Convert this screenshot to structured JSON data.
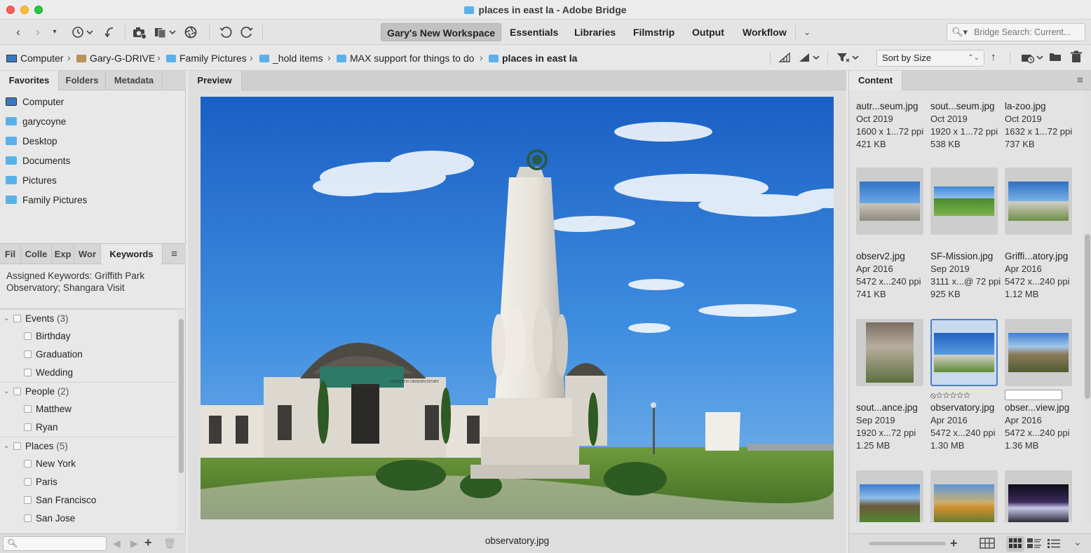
{
  "window": {
    "title": "places in east la - Adobe Bridge"
  },
  "toolbar": {
    "workspaces": [
      "Gary's New Workspace",
      "Essentials",
      "Libraries",
      "Filmstrip",
      "Output",
      "Workflow"
    ],
    "search_placeholder": "Bridge Search: Current..."
  },
  "path": {
    "crumbs": [
      "Computer",
      "Gary-G-DRIVE",
      "Family Pictures",
      "_hold items",
      "MAX support for things to do",
      "places in east la"
    ],
    "sort_label": "Sort by Size"
  },
  "left_panel": {
    "top_tabs": [
      "Favorites",
      "Folders",
      "Metadata"
    ],
    "favorites": [
      "Computer",
      "garycoyne",
      "Desktop",
      "Documents",
      "Pictures",
      "Family Pictures"
    ],
    "bottom_tabs": [
      "Fil",
      "Colle",
      "Exp",
      "Wor",
      "Keywords"
    ],
    "assigned_keywords": "Assigned Keywords: Griffith Park Observatory; Shangara Visit",
    "keywords": [
      {
        "label": "Events",
        "count": "(3)",
        "children": [
          "Birthday",
          "Graduation",
          "Wedding"
        ]
      },
      {
        "label": "People",
        "count": "(2)",
        "children": [
          "Matthew",
          "Ryan"
        ]
      },
      {
        "label": "Places",
        "count": "(5)",
        "children": [
          "New York",
          "Paris",
          "San Francisco",
          "San Jose"
        ]
      }
    ]
  },
  "preview": {
    "tab": "Preview",
    "caption": "observatory.jpg",
    "sign_text": "GRIFFITH OBSERVATORY"
  },
  "content": {
    "tab": "Content",
    "items": [
      {
        "name": "autr...seum.jpg",
        "date": "Oct 2019",
        "dims": "1600 x 1...72 ppi",
        "size": "421 KB"
      },
      {
        "name": "sout...seum.jpg",
        "date": "Oct 2019",
        "dims": "1920 x 1...72 ppi",
        "size": "538 KB"
      },
      {
        "name": "la-zoo.jpg",
        "date": "Oct 2019",
        "dims": "1632 x 1...72 ppi",
        "size": "737 KB"
      },
      {
        "name": "observ2.jpg",
        "date": "Apr 2016",
        "dims": "5472 x...240 ppi",
        "size": "741 KB"
      },
      {
        "name": "SF-Mission.jpg",
        "date": "Sep 2019",
        "dims": "3111 x...@ 72 ppi",
        "size": "925 KB"
      },
      {
        "name": "Griffi...atory.jpg",
        "date": "Apr 2016",
        "dims": "5472 x...240 ppi",
        "size": "1.12 MB"
      },
      {
        "name": "sout...ance.jpg",
        "date": "Sep 2019",
        "dims": "1920 x...72 ppi",
        "size": "1.25 MB"
      },
      {
        "name": "observatory.jpg",
        "date": "Apr 2016",
        "dims": "5472 x...240 ppi",
        "size": "1.30 MB"
      },
      {
        "name": "obser...view.jpg",
        "date": "Apr 2016",
        "dims": "5472 x...240 ppi",
        "size": "1.36 MB"
      }
    ],
    "selected_rating": "⦸☆☆☆☆☆"
  }
}
